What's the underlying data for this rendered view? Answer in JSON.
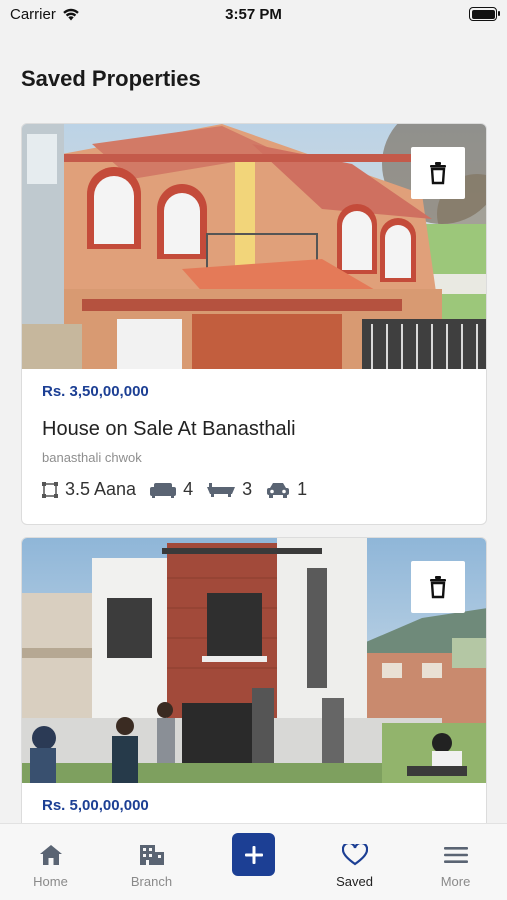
{
  "status": {
    "carrier": "Carrier",
    "time": "3:57 PM"
  },
  "page_title": "Saved Properties",
  "properties": [
    {
      "price": "Rs. 3,50,00,000",
      "title": "House on Sale At Banasthali",
      "location": "banasthali chwok",
      "area": "3.5 Aana",
      "living": "4",
      "bath": "3",
      "parking": "1"
    },
    {
      "price": "Rs. 5,00,00,000"
    }
  ],
  "tabs": [
    {
      "label": "Home",
      "icon": "home-icon"
    },
    {
      "label": "Branch",
      "icon": "building-icon"
    },
    {
      "label": "",
      "icon": "plus-icon"
    },
    {
      "label": "Saved",
      "icon": "heart-icon",
      "active": true
    },
    {
      "label": "More",
      "icon": "menu-icon"
    }
  ],
  "colors": {
    "brand": "#1c3f94",
    "background": "#f2f2f2",
    "muted": "#8e8e8e"
  }
}
